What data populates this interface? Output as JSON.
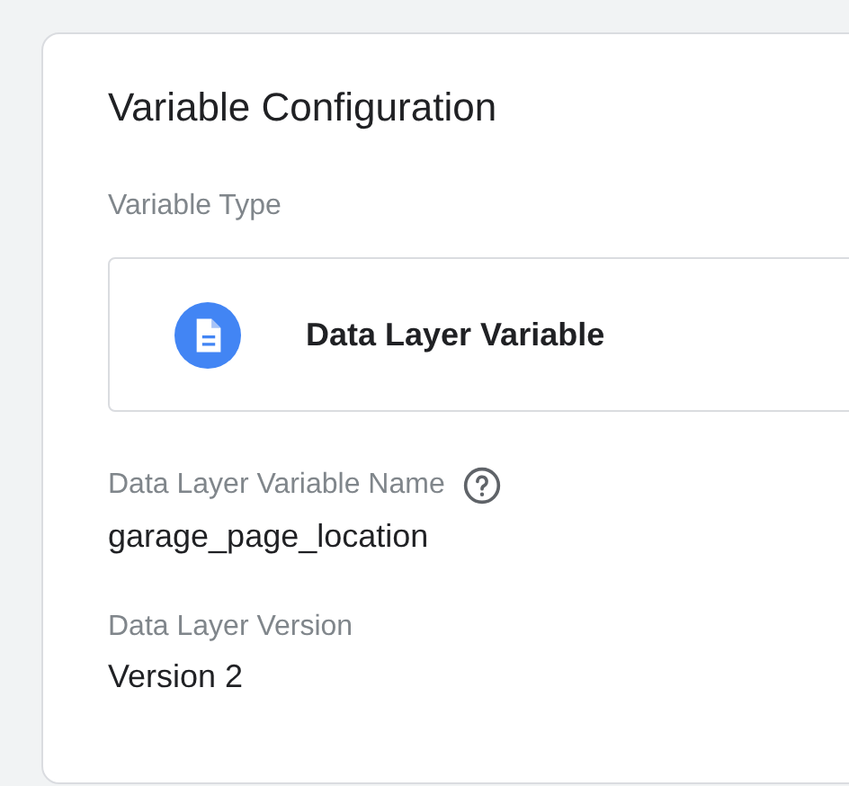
{
  "card": {
    "title": "Variable Configuration"
  },
  "variable_type": {
    "label": "Variable Type",
    "value": "Data Layer Variable"
  },
  "fields": [
    {
      "label": "Data Layer Variable Name",
      "help": true,
      "value": "garage_page_location"
    },
    {
      "label": "Data Layer Version",
      "help": false,
      "value": "Version 2"
    }
  ]
}
